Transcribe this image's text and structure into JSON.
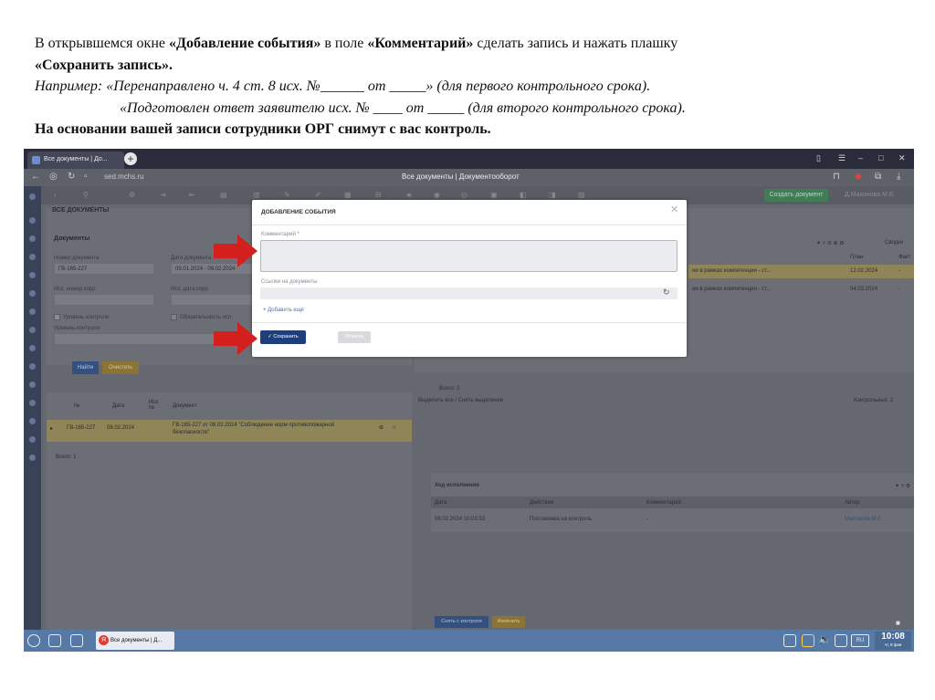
{
  "instructions": {
    "line1_a": "В открывшемся окне ",
    "line1_b": "«Добавление события»",
    "line1_c": " в поле ",
    "line1_d": "«Комментарий»",
    "line1_e": " сделать запись и нажать плашку",
    "line2": "«Сохранить запись».",
    "line3": "Например: «Перенаправлено ч. 4 ст. 8 исх. №______ от _____» (для первого контрольного срока).",
    "line4": "«Подготовлен ответ заявителю исх. № ____ от _____ (для второго контрольного срока).",
    "line5": "На основании вашей записи сотрудники ОРГ снимут с вас контроль."
  },
  "browser": {
    "tab_title": "Все документы | Документооборот",
    "tab_title_short": "Все документы | До...",
    "url": "sed.mchs.ru",
    "page_title": "Все документы | Документооборот"
  },
  "app": {
    "create_button": "Создать документ",
    "user": "Д.Махонова М.Е.",
    "section_title": "ВСЕ ДОКУМЕНТЫ",
    "filter": {
      "header": "Документы",
      "doc_number_label": "Номер документа",
      "doc_number_value": "ГВ-165-227",
      "doc_date_label": "Дата документа",
      "doc_date_value": "09.01.2024 - 09.02.2024",
      "in_number_label": "Исх. номер корр.",
      "in_date_label": "Исх. дата корр.",
      "on_control_label": "Уровень контроля",
      "level_label": "Уровень контроля",
      "required_label": "Обязательность исп.",
      "find_button": "Найти",
      "clear_button": "Очистить"
    },
    "list": {
      "col_num": "№",
      "col_date": "Дата",
      "col_out": "Исх №",
      "col_doc": "Документ",
      "row_num": "ГВ-165-227",
      "row_date": "08.02.2024",
      "row_text_1": "ГВ-165-227 от 08.02.2024 \"Соблюдение норм противопожарной",
      "row_text_2": "безопасности\"",
      "total": "Всего: 1"
    },
    "right": {
      "col_plan": "План",
      "col_fact": "Факт",
      "row1_text": "ии в рамках компетенции - ст...",
      "row1_plan": "12.02.2024",
      "row1_fact": "-",
      "row2_text": "ии в рамках компетенции - ст...",
      "row2_plan": "04.03.2024",
      "row2_fact": "-",
      "view_label": "Сводки",
      "total": "Всего: 2",
      "select_all": "Выделить все / Снять выделение",
      "controlled": "Контрольных: 2"
    },
    "history": {
      "title": "Ход исполнения",
      "col_date": "Дата",
      "col_action": "Действие",
      "col_comment": "Комментарий",
      "col_author": "Автор",
      "row_date": "08.02.2024 10:03:33",
      "row_action": "Постановка на контроль",
      "row_comment": "-",
      "row_author": "Махонова М.Е."
    },
    "remove_button": "Снять с контроля",
    "change_button": "Изменить"
  },
  "dialog": {
    "title": "ДОБАВЛЕНИЕ СОБЫТИЯ",
    "comment_label": "Комментарий *",
    "links_label": "Ссылки на документы",
    "add_more": "Добавить еще",
    "save_button": "✓ Сохранить запись",
    "cancel_button": "Отмена"
  },
  "taskbar": {
    "task_label": "Все документы | Д...",
    "lang": "RU",
    "time": "10:08",
    "date": "чт, 8 фев"
  },
  "colors": {
    "arrow": "#d41f1f",
    "save_button": "#1f3f7a",
    "taskbar": "#5679a6"
  }
}
